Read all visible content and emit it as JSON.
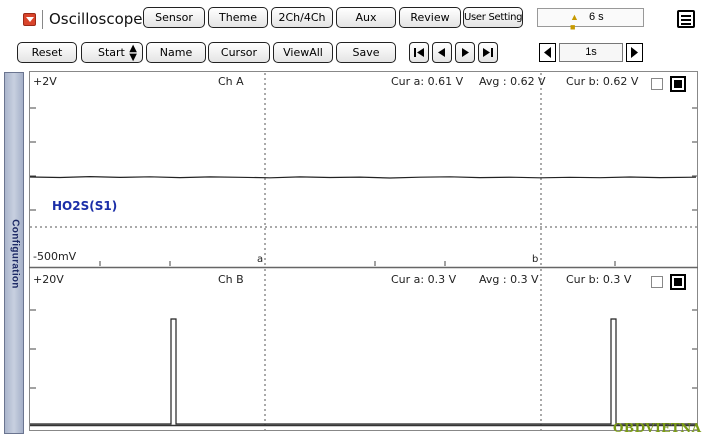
{
  "app": {
    "title": "Oscilloscope"
  },
  "toolbar_top": {
    "buttons": [
      "Sensor",
      "Theme",
      "2Ch/4Ch",
      "Aux",
      "Review",
      "User Setting"
    ],
    "time_display": "6 s"
  },
  "toolbar_second": {
    "buttons": [
      "Reset",
      "Start",
      "Name",
      "Cursor",
      "ViewAll",
      "Save"
    ],
    "period_value": "1s"
  },
  "side_panel": {
    "label": "Configuration"
  },
  "channels": [
    {
      "name": "Ch A",
      "scale_top": "+2V",
      "scale_bottom": "-500mV",
      "cur_a": "Cur a: 0.61 V",
      "avg": "Avg  : 0.62 V",
      "cur_b": "Cur b: 0.62 V",
      "sensor": "HO2S(S1)",
      "cursor_a_label": "a",
      "cursor_b_label": "b"
    },
    {
      "name": "Ch B",
      "scale_top": "+20V",
      "cur_a": "Cur a: 0.3 V",
      "avg": "Avg  : 0.3 V",
      "cur_b": "Cur b: 0.3 V"
    }
  ],
  "watermark": "OBDVIETNAM",
  "colors": {
    "accent": "#d9442b",
    "trace": "#111111",
    "grid": "#555555",
    "sensor_text": "#1b2ea8",
    "watermark": "#7a9a16"
  }
}
